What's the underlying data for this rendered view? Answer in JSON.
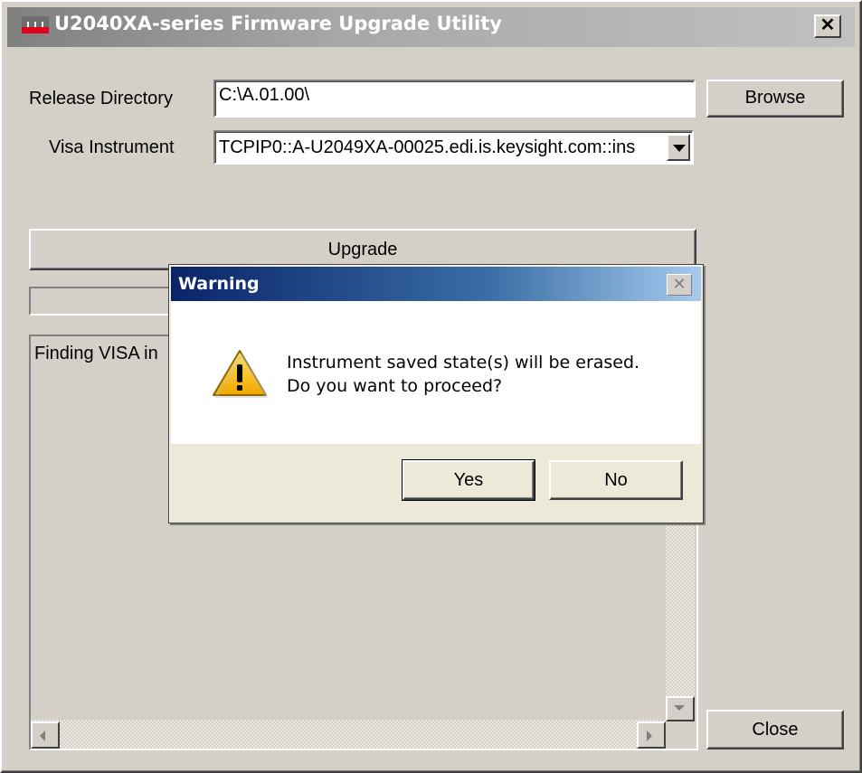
{
  "window": {
    "title": "U2040XA-series Firmware Upgrade Utility",
    "close_glyph": "✕"
  },
  "form": {
    "release_dir_label": "Release Directory",
    "release_dir_value": "C:\\A.01.00\\",
    "visa_label": "Visa Instrument",
    "visa_value": "TCPIP0::A-U2049XA-00025.edi.is.keysight.com::ins"
  },
  "buttons": {
    "browse": "Browse",
    "upgrade": "Upgrade",
    "close": "Close"
  },
  "log": {
    "text": "Finding VISA in"
  },
  "dialog": {
    "title": "Warning",
    "close_glyph": "✕",
    "message_line1": "Instrument saved state(s) will be erased.",
    "message_line2": "Do you want to proceed?",
    "yes": "Yes",
    "no": "No"
  },
  "colors": {
    "accent_red": "#e2001a",
    "dialog_title_start": "#0a246a",
    "dialog_title_end": "#a6caf0"
  }
}
